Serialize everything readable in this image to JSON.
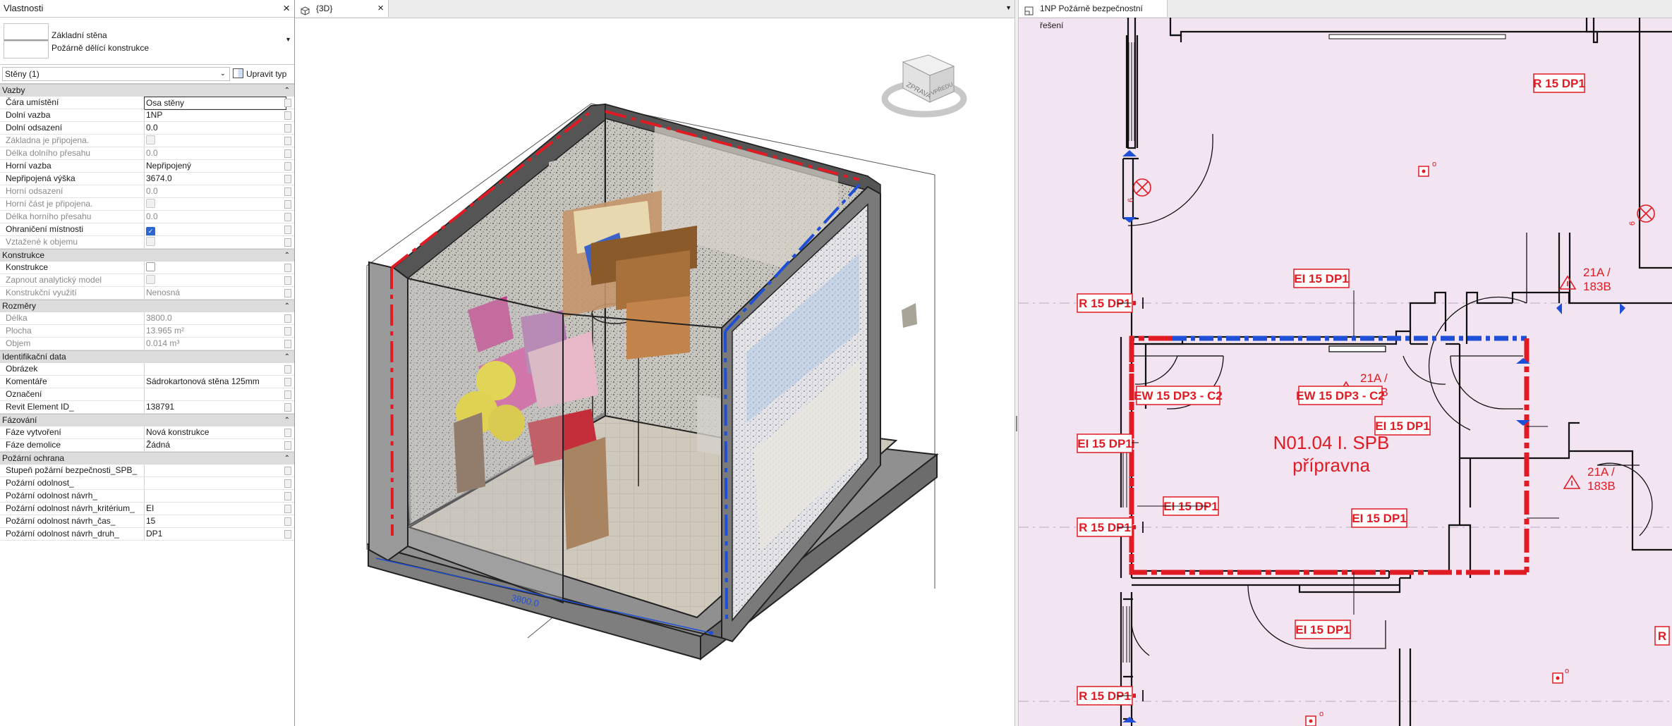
{
  "properties_panel": {
    "title": "Vlastnosti",
    "close_icon": "close-icon",
    "type_family": "Základní stěna",
    "type_name": "Požárně dělící konstrukce",
    "filter": "Stěny (1)",
    "edit_type": "Upravit typ",
    "sections": [
      {
        "title": "Vazby",
        "rows": [
          {
            "k": "Čára umístění",
            "v": "Osa stěny",
            "state": "selected"
          },
          {
            "k": "Dolní vazba",
            "v": "1NP"
          },
          {
            "k": "Dolní odsazení",
            "v": "0.0"
          },
          {
            "k": "Základna je připojena.",
            "v": "",
            "state": "disabled",
            "checkbox": "disabled"
          },
          {
            "k": "Délka dolního přesahu",
            "v": "0.0",
            "state": "disabled"
          },
          {
            "k": "Horní vazba",
            "v": "Nepřipojený"
          },
          {
            "k": "Nepřipojená výška",
            "v": "3674.0"
          },
          {
            "k": "Horní odsazení",
            "v": "0.0",
            "state": "disabled"
          },
          {
            "k": "Horní část je připojena.",
            "v": "",
            "state": "disabled",
            "checkbox": "disabled"
          },
          {
            "k": "Délka horního přesahu",
            "v": "0.0",
            "state": "disabled"
          },
          {
            "k": "Ohraničení místnosti",
            "v": "",
            "checkbox": "on"
          },
          {
            "k": "Vztažené k objemu",
            "v": "",
            "state": "disabled",
            "checkbox": "disabled"
          }
        ]
      },
      {
        "title": "Konstrukce",
        "rows": [
          {
            "k": "Konstrukce",
            "v": "",
            "checkbox": "off"
          },
          {
            "k": "Zapnout analytický model",
            "v": "",
            "state": "disabled",
            "checkbox": "disabled"
          },
          {
            "k": "Konstrukční využití",
            "v": "Nenosná",
            "state": "disabled"
          }
        ]
      },
      {
        "title": "Rozměry",
        "rows": [
          {
            "k": "Délka",
            "v": "3800.0",
            "state": "disabled"
          },
          {
            "k": "Plocha",
            "v": "13.965 m²",
            "state": "disabled"
          },
          {
            "k": "Objem",
            "v": "0.014 m³",
            "state": "disabled"
          }
        ]
      },
      {
        "title": "Identifikační data",
        "rows": [
          {
            "k": "Obrázek",
            "v": ""
          },
          {
            "k": "Komentáře",
            "v": "Sádrokartonová stěna 125mm"
          },
          {
            "k": "Označení",
            "v": ""
          },
          {
            "k": "Revit Element ID_",
            "v": "138791"
          }
        ]
      },
      {
        "title": "Fázování",
        "rows": [
          {
            "k": "Fáze vytvoření",
            "v": "Nová konstrukce"
          },
          {
            "k": "Fáze demolice",
            "v": "Žádná"
          }
        ]
      },
      {
        "title": "Požární ochrana",
        "rows": [
          {
            "k": "Stupeň požární bezpečnosti_SPB_",
            "v": ""
          },
          {
            "k": "Požární odolnost_",
            "v": ""
          },
          {
            "k": "Požární odolnost návrh_",
            "v": ""
          },
          {
            "k": "Požární odolnost návrh_kritérium_",
            "v": "EI"
          },
          {
            "k": "Požární odolnost návrh_čas_",
            "v": "15"
          },
          {
            "k": "Požární odolnost návrh_druh_",
            "v": "DP1"
          }
        ]
      }
    ]
  },
  "view3d": {
    "tab_label": "{3D}",
    "viewcube_left": "ZPRAVA",
    "viewcube_right": "VPŘEDU",
    "dimension_text": "3800.0"
  },
  "plan": {
    "tab_label": "1NP Požárně bezpečnostní řešení",
    "room_name": "N01.04 I. SPB",
    "room_label": "přípravna",
    "labels": {
      "r15_top": "R 15 DP1",
      "ei15_top": "EI 15 DP1",
      "r15_left1": "R 15 DP1",
      "ew_left": "EW 15 DP3 - C2",
      "ew_right": "EW 15 DP3 - C2",
      "ei15_left": "EI 15 DP1",
      "ei15_right": "EI 15 DP1",
      "ei15_inner": "EI 15 DP1",
      "r15_left2": "R 15 DP1",
      "ei15_right2": "EI 15 DP1",
      "ei15_bottom": "EI 15 DP1",
      "r15_left3": "R 15 DP1",
      "r_cut": "R"
    },
    "escape": {
      "a_top": "21A /",
      "b_top": "183B",
      "a_mid": "21A /",
      "b_mid": "183B",
      "a_right": "21A /",
      "b_right": "183B"
    },
    "marker_small": "o",
    "marker_rot": "6"
  },
  "colors": {
    "fire_red": "#e01b24",
    "wall_blue": "#1f4fd6",
    "plan_bg": "#f2e4f0"
  }
}
